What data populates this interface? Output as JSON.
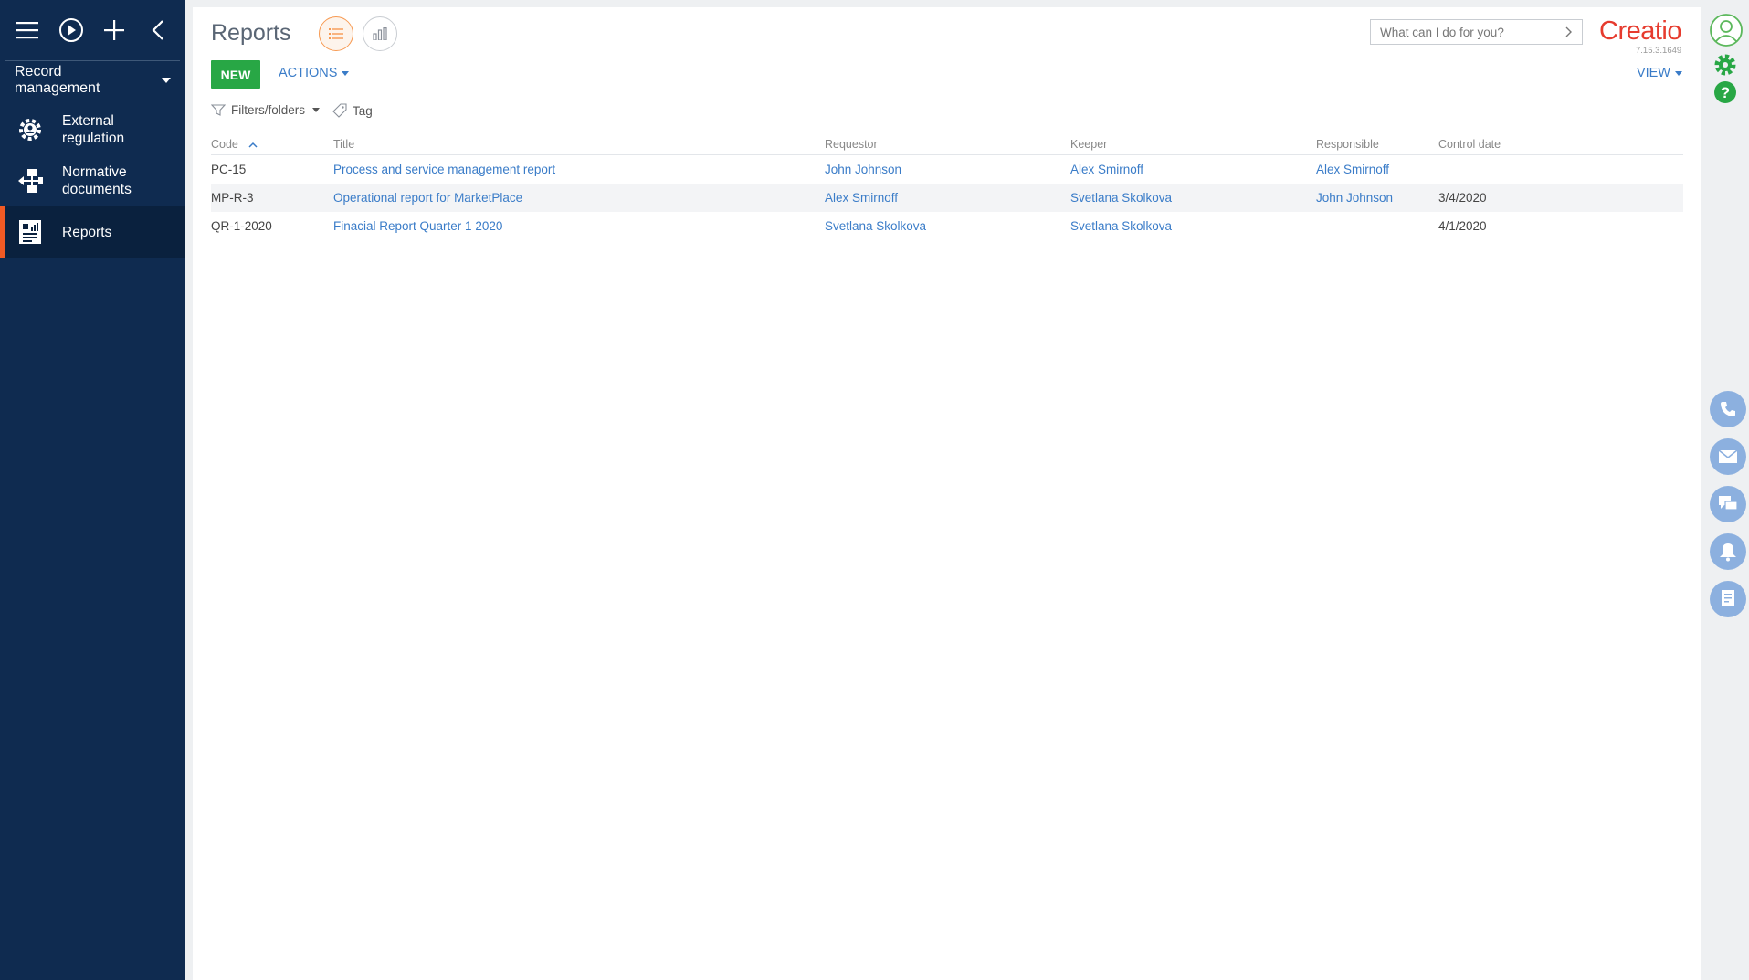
{
  "sidebar": {
    "workplace": "Record management",
    "items": [
      {
        "label": "External regulation",
        "icon": "gear-shield-icon"
      },
      {
        "label": "Normative documents",
        "icon": "document-flow-icon"
      },
      {
        "label": "Reports",
        "icon": "report-icon"
      }
    ]
  },
  "page": {
    "title": "Reports",
    "new_label": "NEW",
    "actions_label": "ACTIONS",
    "view_label": "VIEW",
    "filters_label": "Filters/folders",
    "tag_label": "Tag"
  },
  "search": {
    "placeholder": "What can I do for you?"
  },
  "brand": {
    "logo": "Creatio",
    "version": "7.15.3.1649",
    "color": "#e63b2e"
  },
  "table": {
    "columns": [
      "Code",
      "Title",
      "Requestor",
      "Keeper",
      "Responsible",
      "Control date"
    ],
    "rows": [
      {
        "code": "PC-15",
        "title": "Process and service management report",
        "requestor": "John Johnson",
        "keeper": "Alex Smirnoff",
        "responsible": "Alex Smirnoff",
        "control_date": ""
      },
      {
        "code": "MP-R-3",
        "title": "Operational report for MarketPlace",
        "requestor": "Alex Smirnoff",
        "keeper": "Svetlana Skolkova",
        "responsible": "John Johnson",
        "control_date": "3/4/2020"
      },
      {
        "code": "QR-1-2020",
        "title": "Finacial Report Quarter 1 2020",
        "requestor": "Svetlana Skolkova",
        "keeper": "Svetlana Skolkova",
        "responsible": "",
        "control_date": "4/1/2020"
      }
    ]
  },
  "colors": {
    "sidebar": "#0f2b50",
    "accent": "#f15a24",
    "new_button": "#28a745",
    "link": "#3a7cc8"
  }
}
